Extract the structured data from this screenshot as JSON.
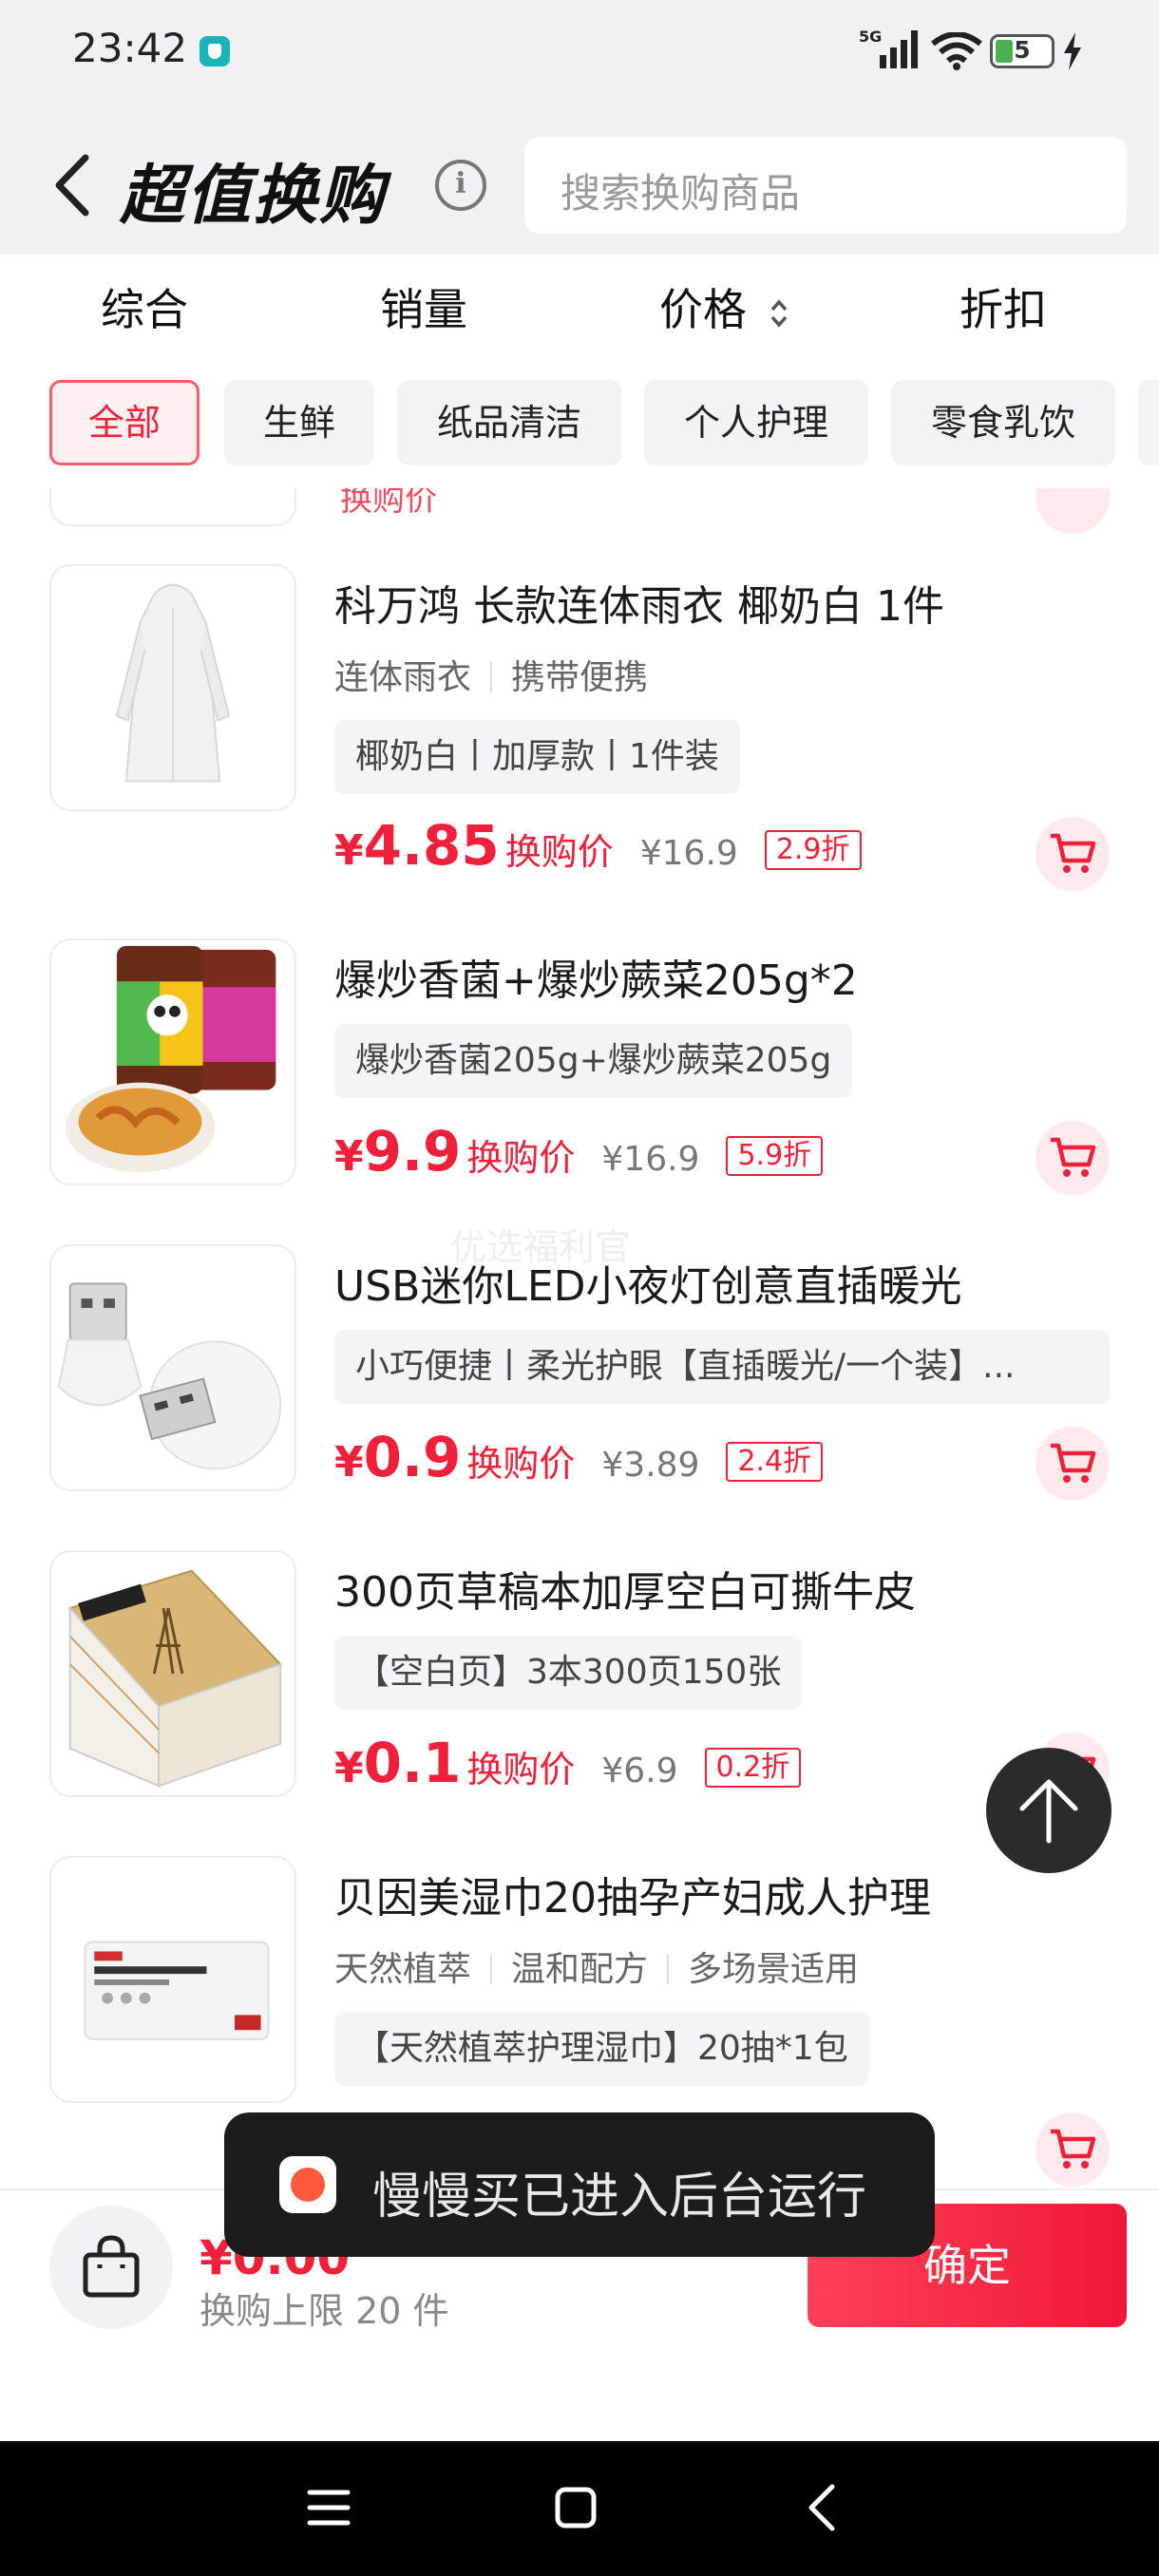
{
  "status_bar": {
    "time": "23:42",
    "network": "5G",
    "battery": "5",
    "signal_icon": "signal-icon",
    "wifi_icon": "wifi-icon",
    "charging_icon": "bolt-icon"
  },
  "header": {
    "title": "超值换购",
    "info_glyph": "i",
    "search_placeholder": "搜索换购商品"
  },
  "sort_tabs": [
    {
      "label": "综合"
    },
    {
      "label": "销量"
    },
    {
      "label": "价格"
    },
    {
      "label": "折扣"
    }
  ],
  "categories": [
    {
      "label": "全部",
      "active": true
    },
    {
      "label": "生鲜"
    },
    {
      "label": "纸品清洁"
    },
    {
      "label": "个人护理"
    },
    {
      "label": "零食乳饮"
    }
  ],
  "products": [
    {
      "title": "科万鸿 长款连体雨衣 椰奶白 1件",
      "tags": [
        "连体雨衣",
        "携带便携"
      ],
      "spec": "椰奶白丨加厚款丨1件装",
      "currency": "¥",
      "price": "4.85",
      "price_label": "换购价",
      "original_price": "¥16.9",
      "discount": "2.9折"
    },
    {
      "title": "爆炒香菌+爆炒蕨菜205g*2",
      "tags": [],
      "spec": "爆炒香菌205g+爆炒蕨菜205g",
      "currency": "¥",
      "price": "9.9",
      "price_label": "换购价",
      "original_price": "¥16.9",
      "discount": "5.9折"
    },
    {
      "title": "USB迷你LED小夜灯创意直插暖光",
      "tags": [],
      "spec": "小巧便捷丨柔光护眼【直插暖光/一个装】...",
      "currency": "¥",
      "price": "0.9",
      "price_label": "换购价",
      "original_price": "¥3.89",
      "discount": "2.4折"
    },
    {
      "title": "300页草稿本加厚空白可撕牛皮",
      "tags": [],
      "spec": "【空白页】3本300页150张",
      "currency": "¥",
      "price": "0.1",
      "price_label": "换购价",
      "original_price": "¥6.9",
      "discount": "0.2折"
    },
    {
      "title": "贝因美湿巾20抽孕产妇成人护理",
      "tags": [
        "天然植萃",
        "温和配方",
        "多场景适用"
      ],
      "spec": "【天然植萃护理湿巾】20抽*1包",
      "currency": "¥",
      "price": "",
      "price_label": "",
      "original_price": "",
      "discount": ""
    }
  ],
  "partial_item": {
    "price_label": "换购价"
  },
  "watermark": "优选福利官",
  "bottom_bar": {
    "total": "¥0.00",
    "limit_text": "换购上限 20 件",
    "confirm_label": "确定"
  },
  "toast": {
    "message": "慢慢买已进入后台运行"
  },
  "colors": {
    "accent": "#f0203a",
    "header_bg": "#f1f1f3",
    "toast_bg": "#1c1c1c"
  }
}
